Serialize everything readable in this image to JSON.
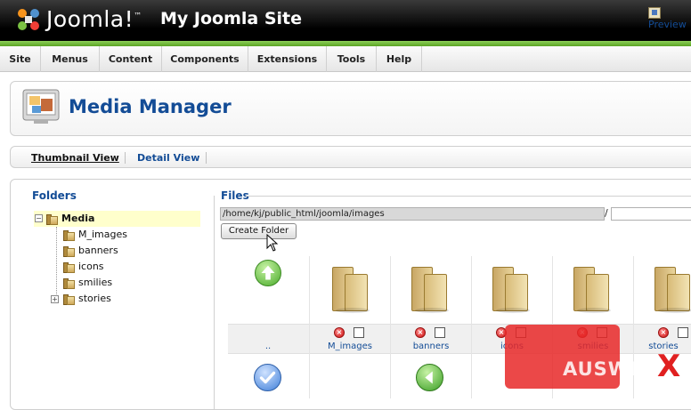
{
  "header": {
    "logo_text": "Joomla!",
    "site_title": "My Joomla Site"
  },
  "menu": {
    "items": [
      {
        "label": "Site"
      },
      {
        "label": "Menus"
      },
      {
        "label": "Content"
      },
      {
        "label": "Components"
      },
      {
        "label": "Extensions"
      },
      {
        "label": "Tools"
      },
      {
        "label": "Help"
      }
    ],
    "preview_label": "Preview"
  },
  "page": {
    "title": "Media Manager",
    "icon": "media-manager-icon"
  },
  "tabs": [
    {
      "label": "Thumbnail View",
      "active": true
    },
    {
      "label": "Detail View",
      "active": false
    }
  ],
  "folders": {
    "title": "Folders",
    "root": "Media",
    "children": [
      "M_images",
      "banners",
      "icons",
      "smilies",
      "stories"
    ]
  },
  "files": {
    "title": "Files",
    "path": "/home/kj/public_html/joomla/images",
    "separator": "/",
    "folder_name_value": "",
    "create_folder_label": "Create Folder",
    "up_label": "..",
    "items": [
      {
        "name": "M_images"
      },
      {
        "name": "banners"
      },
      {
        "name": "icons"
      },
      {
        "name": "smilies"
      },
      {
        "name": "stories"
      }
    ]
  },
  "watermark": {
    "text": "AUSWEB",
    "mark": "X"
  },
  "colors": {
    "accent_blue": "#134c96",
    "header_black": "#000000",
    "header_green": "#5aa324",
    "watermark_red": "#e82828"
  }
}
